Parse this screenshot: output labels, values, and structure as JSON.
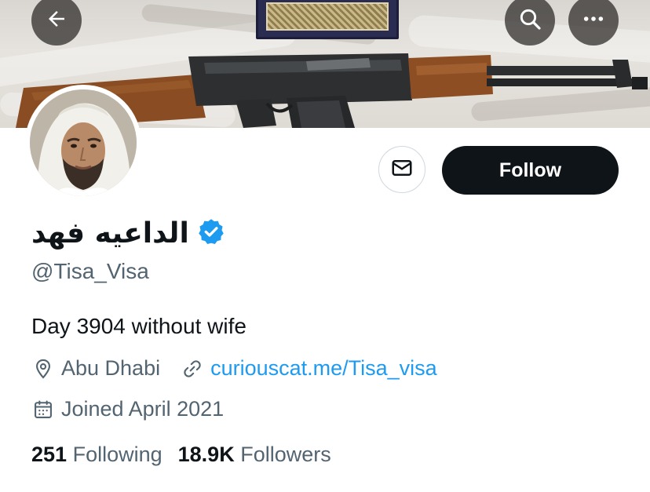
{
  "header": {
    "back_icon": "arrow-left-icon",
    "search_icon": "search-icon",
    "more_icon": "more-horizontal-icon"
  },
  "profile": {
    "display_name": "الداعيه فهد",
    "verified": true,
    "verified_color": "#1d9bf0",
    "handle": "@Tisa_Visa",
    "bio": "Day 3904 without wife",
    "location": "Abu Dhabi",
    "website": "curiouscat.me/Tisa_visa",
    "joined": "Joined April 2021"
  },
  "actions": {
    "follow_label": "Follow",
    "message_icon": "envelope-icon"
  },
  "stats": {
    "following_count": "251",
    "following_label": "Following",
    "followers_count": "18.9K",
    "followers_label": "Followers"
  },
  "colors": {
    "text_primary": "#0f1419",
    "text_secondary": "#536471",
    "link": "#1d9bf0",
    "button_dark": "#0f1419"
  }
}
